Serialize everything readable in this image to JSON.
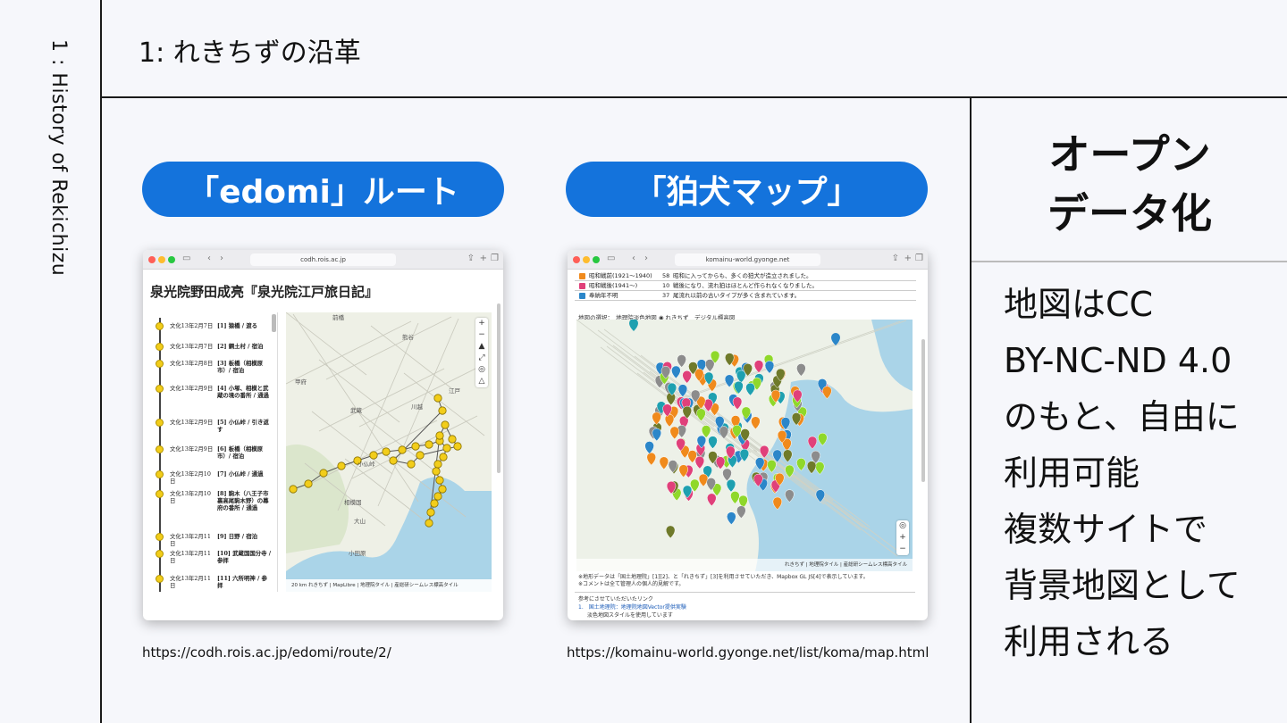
{
  "slide": {
    "side_title": "1 : History of Rekichizu",
    "title": "1: れきちずの沿革"
  },
  "left": {
    "pill": "「edomi」ルート",
    "caption": "https://codh.rois.ac.jp/edomi/route/2/",
    "browser": {
      "url": "codh.rois.ac.jp",
      "page_title": "泉光院野田成亮『泉光院江戸旅日記』",
      "timeline": [
        {
          "date": "文化13年2月7日",
          "place": "[1] 猿橋 / 渡る"
        },
        {
          "date": "文化13年2月7日",
          "place": "[2] 鋼土村 / 宿泊"
        },
        {
          "date": "文化13年2月8日",
          "place": "[3] 板橋（相模原市）/ 宿泊"
        },
        {
          "date": "文化13年2月9日",
          "place": "[4] 小塚、相模と武蔵の境の番所 / 通過"
        },
        {
          "date": "文化13年2月9日",
          "place": "[5] 小仏峠 / 引き返す"
        },
        {
          "date": "文化13年2月9日",
          "place": "[6] 板橋（相模原市）/ 宿泊"
        },
        {
          "date": "文化13年2月10日",
          "place": "[7] 小仏峠 / 通過"
        },
        {
          "date": "文化13年2月10日",
          "place": "[8] 駒木（八王子市裏高尾駒木野）の幕府の番所 / 通過"
        },
        {
          "date": "文化13年2月11日",
          "place": "[9] 日野 / 宿泊"
        },
        {
          "date": "文化13年2月11日",
          "place": "[10] 武蔵国国分寺 / 参拝"
        },
        {
          "date": "文化13年2月11日",
          "place": "[11] 六所明神 / 参拝"
        }
      ],
      "map_labels": [
        "前橋",
        "熊谷",
        "川越",
        "武蔵",
        "小仏峠",
        "相模国",
        "大山",
        "小田原",
        "江戸",
        "甲府"
      ],
      "attribution": "20 km    れきちず | MapLibre | 地理院タイル | 産総研シームレス標高タイル"
    }
  },
  "middle": {
    "pill": "「狛犬マップ」",
    "caption": "https://komainu-world.gyonge.net/list/koma/map.html",
    "browser": {
      "url": "komainu-world.gyonge.net",
      "table": [
        {
          "name": "昭和戦前(1921～1940)",
          "count": "58",
          "desc": "昭和に入ってからも、多くの狛犬が造立されました。",
          "color": "#f08a1c"
        },
        {
          "name": "昭和戦後(1941～)",
          "count": "10",
          "desc": "戦後になり、流れ狛はほとんど作られなくなりました。",
          "color": "#e0407a"
        },
        {
          "name": "奉納年不明",
          "count": "37",
          "desc": "尾流れ以前の古いタイプが多く含まれています。",
          "color": "#2b86c9"
        }
      ],
      "map_select": "地図の選択：　地理院淡色地図 ◉ れきちず　デジタル標高図",
      "attribution": "れきちず | 地理院タイル | 産総研シームレス標高タイル",
      "note_1": "※地形データは「国土地理院」[1][2]、と「れきちず」[3]を利用させていただき、Mapbox GL JS[4]で表示しています。",
      "note_2": "※コメントは全て管理人の個人的見解です。",
      "ref_title": "参考にさせていただいたリンク",
      "ref_1": "1.　国土地理院：地理院地図Vector提供実験",
      "ref_1_sub": "淡色地図スタイルを使用しています"
    }
  },
  "right": {
    "heading_1": "オープン",
    "heading_2": "データ化",
    "lines": [
      "地図はCC",
      "BY-NC-ND 4.0",
      "のもと、自由に",
      "利用可能",
      "複数サイトで",
      "背景地図として",
      "利用される"
    ]
  },
  "colors": {
    "accent": "#1473dc",
    "route_marker": "#f2cd1a",
    "komainu_markers": [
      "#f08a1c",
      "#e0407a",
      "#2b86c9",
      "#8fd82a",
      "#8c8c8c",
      "#6f7a2a",
      "#1ea0b0"
    ]
  }
}
